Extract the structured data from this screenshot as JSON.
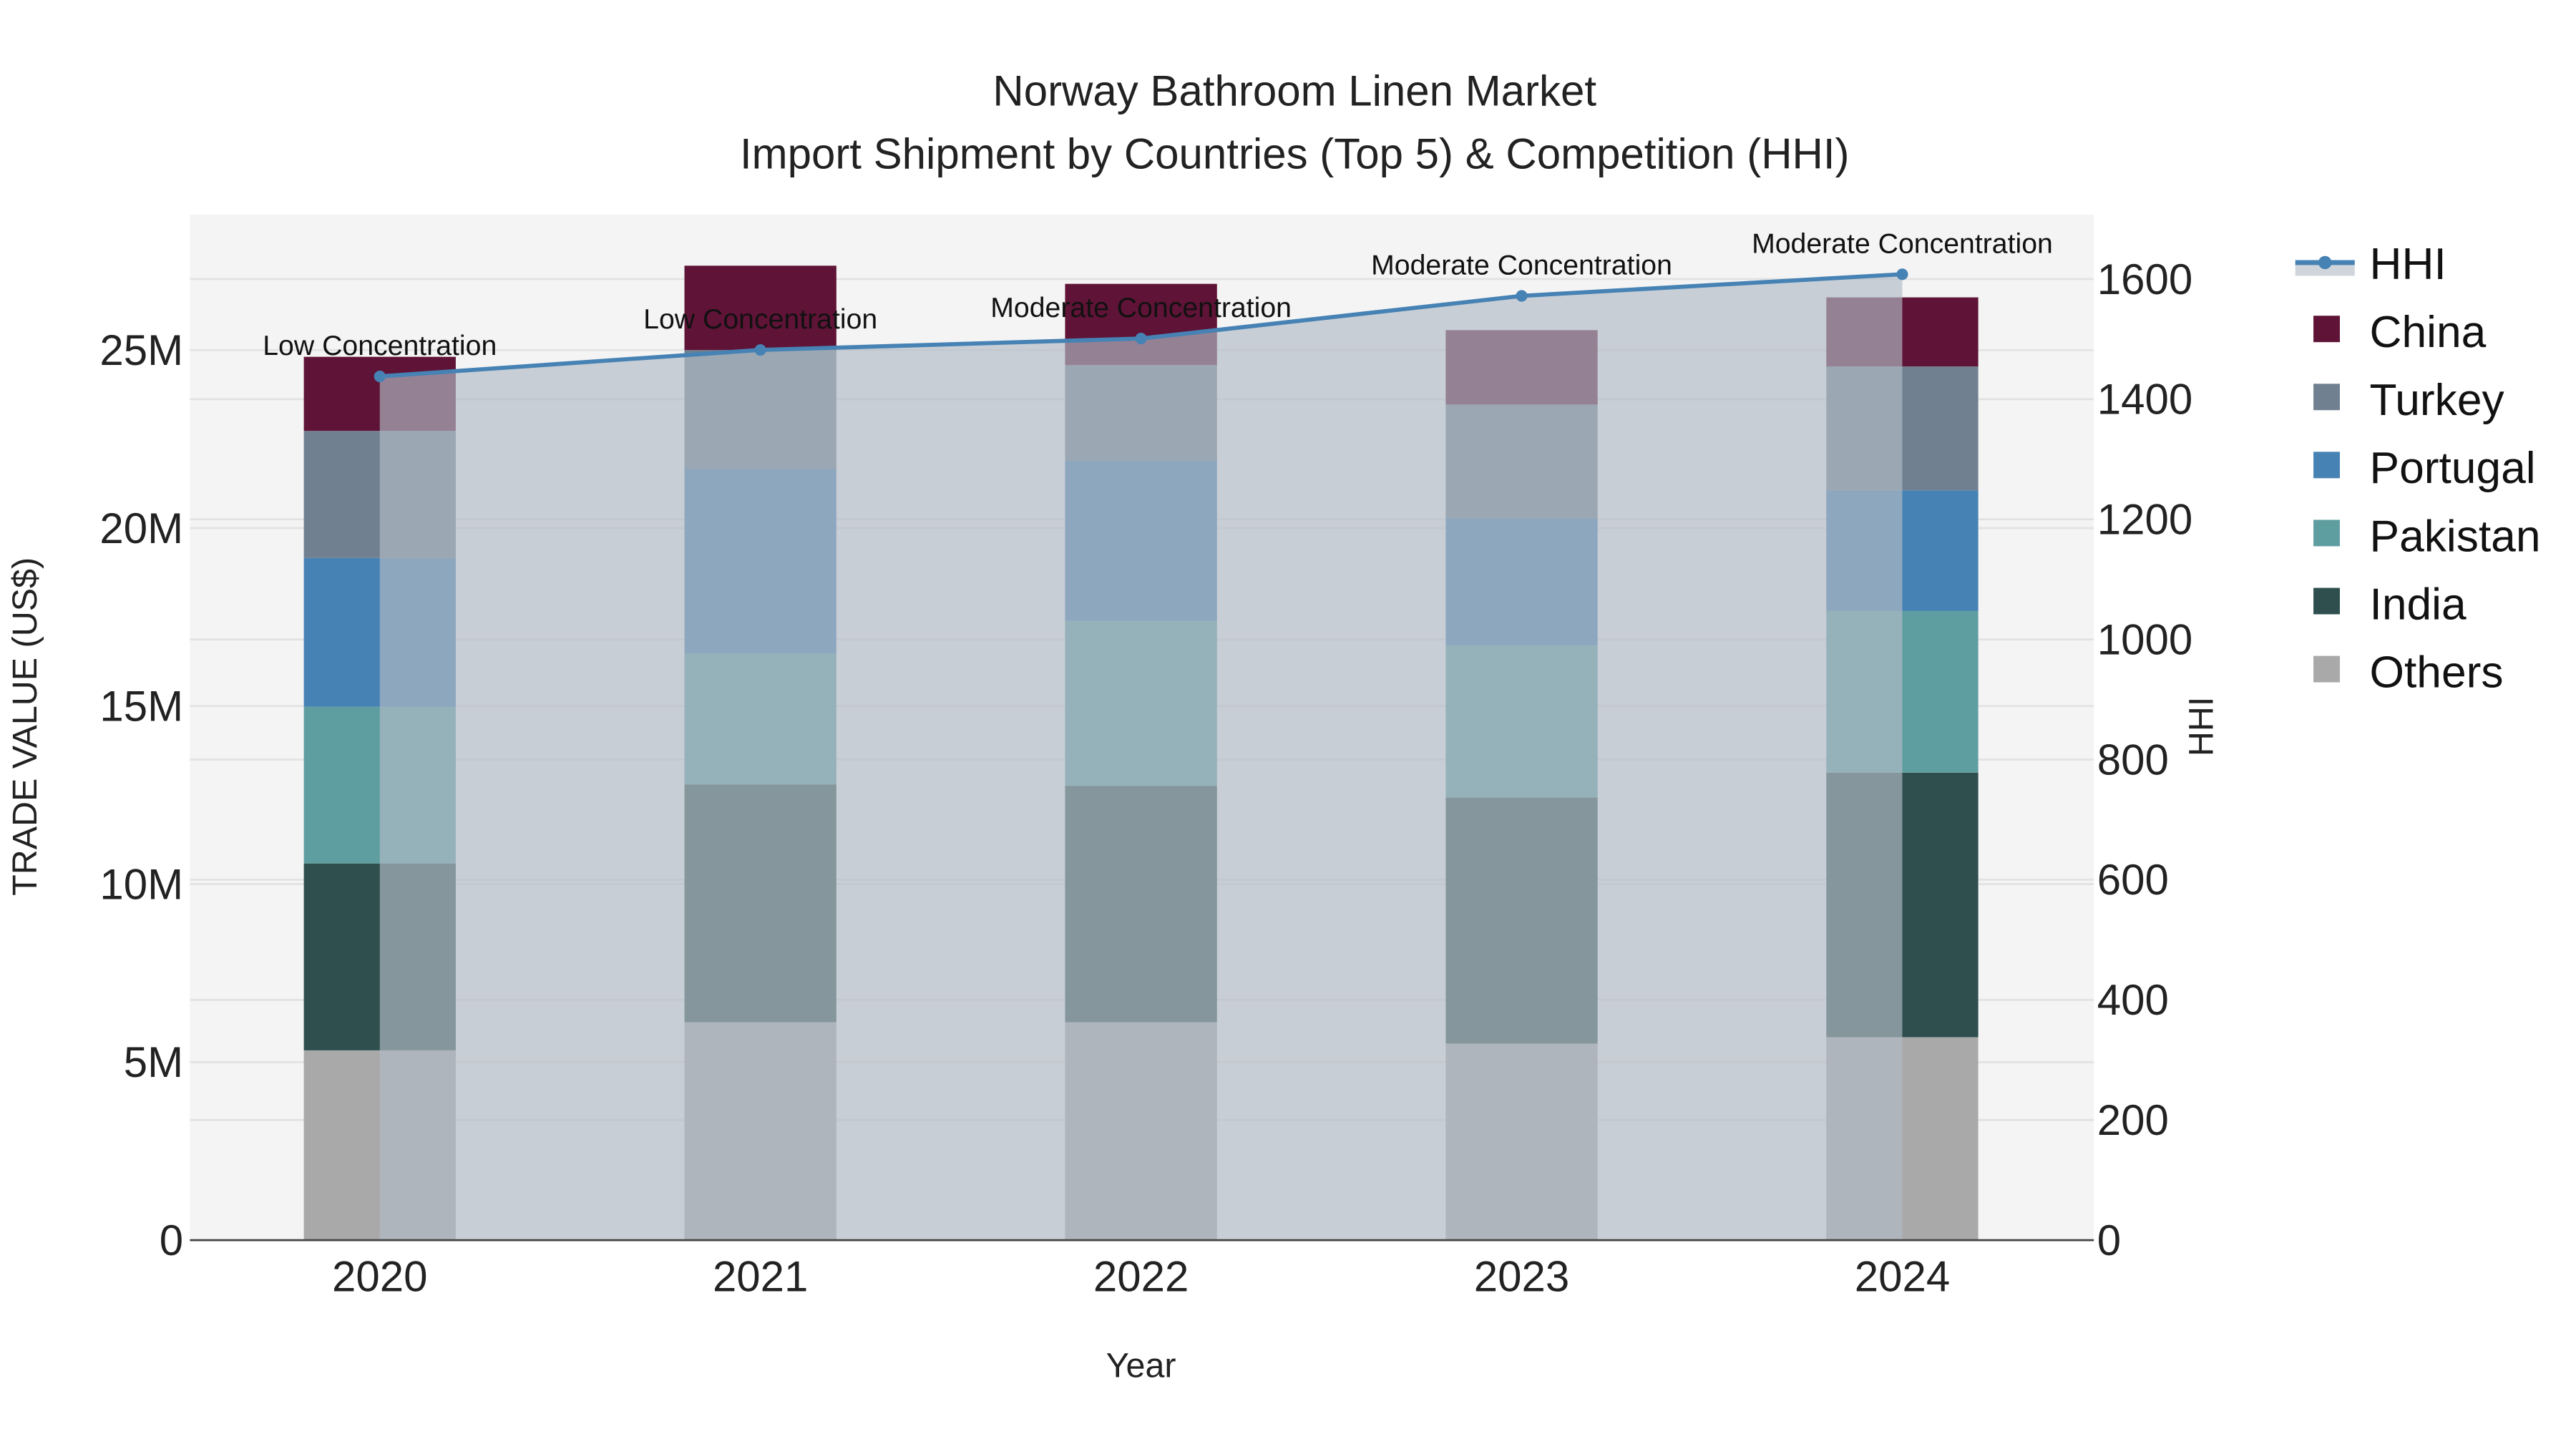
{
  "chart_data": {
    "type": "bar",
    "title": "Norway Bathroom Linen Market",
    "subtitle": "Import Shipment by Countries (Top 5) & Competition (HHI)",
    "xlabel": "Year",
    "ylabel": "TRADE VALUE (US$)",
    "y2label": "HHI",
    "categories": [
      "2020",
      "2021",
      "2022",
      "2023",
      "2024"
    ],
    "ylim": [
      0,
      28.7
    ],
    "y_unit": "million US$",
    "y_ticks": [
      0,
      5,
      10,
      15,
      20,
      25
    ],
    "y_tick_labels": [
      "0",
      "5M",
      "10M",
      "15M",
      "20M",
      "25M"
    ],
    "y2lim": [
      0,
      1700
    ],
    "y2_ticks": [
      0,
      200,
      400,
      600,
      800,
      1000,
      1200,
      1400,
      1600
    ],
    "y2_tick_labels": [
      "0",
      "200",
      "400",
      "600",
      "800",
      "1000",
      "1200",
      "1400",
      "1600"
    ],
    "grid": true,
    "legend_position": "right",
    "series": [
      {
        "name": "Others",
        "color": "#a9a9a9",
        "values": [
          5.33,
          6.12,
          6.12,
          5.52,
          5.7
        ]
      },
      {
        "name": "India",
        "color": "#2f4f4f",
        "values": [
          5.25,
          6.68,
          6.64,
          6.91,
          7.43
        ]
      },
      {
        "name": "Pakistan",
        "color": "#5f9ea0",
        "values": [
          4.4,
          3.67,
          4.63,
          4.27,
          4.54
        ]
      },
      {
        "name": "Portugal",
        "color": "#4682b4",
        "values": [
          4.18,
          5.19,
          4.5,
          3.57,
          3.39
        ]
      },
      {
        "name": "Turkey",
        "color": "#708090",
        "values": [
          3.57,
          3.34,
          2.69,
          3.2,
          3.48
        ]
      },
      {
        "name": "China",
        "color": "#5f1336",
        "values": [
          2.08,
          2.37,
          2.28,
          2.09,
          1.94
        ]
      }
    ],
    "hhi": {
      "name": "HHI",
      "color": "#4682b4",
      "values": [
        1438,
        1482,
        1501,
        1572,
        1608
      ],
      "annotations": [
        "Low Concentration",
        "Low Concentration",
        "Moderate Concentration",
        "Moderate Concentration",
        "Moderate Concentration"
      ]
    },
    "legend": [
      "HHI",
      "China",
      "Turkey",
      "Portugal",
      "Pakistan",
      "India",
      "Others"
    ]
  }
}
